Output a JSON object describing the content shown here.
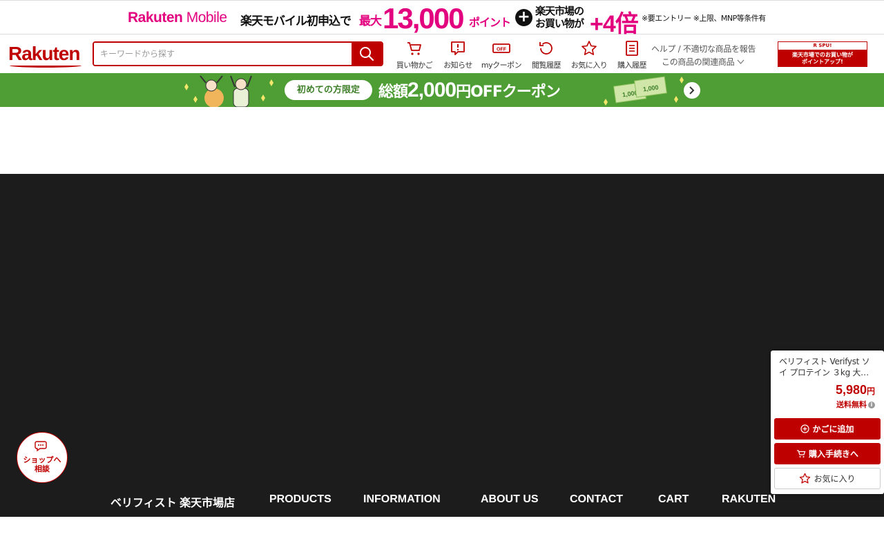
{
  "promo": {
    "brand": "Rakuten",
    "brand_sub": "Mobile",
    "text1": "楽天モバイル初申込で",
    "text2": "最大",
    "points": "13,000",
    "points_unit": "ポイント",
    "plus": "+",
    "text3_line1": "楽天市場の",
    "text3_line2": "お買い物が",
    "multiplier": "+4倍",
    "note": "※要エントリー ※上限、MNP等条件有"
  },
  "header": {
    "logo": "Rakuten",
    "search_placeholder": "キーワードから探す",
    "nav": [
      {
        "label": "買い物かご",
        "icon": "cart-icon"
      },
      {
        "label": "お知らせ",
        "icon": "notice-icon"
      },
      {
        "label": "myクーポン",
        "icon": "coupon-icon"
      },
      {
        "label": "閲覧履歴",
        "icon": "history-icon"
      },
      {
        "label": "お気に入り",
        "icon": "star-icon"
      },
      {
        "label": "購入履歴",
        "icon": "purchase-list-icon"
      }
    ],
    "help_link": "ヘルプ / 不適切な商品を報告",
    "related_link": "この商品の関連商品",
    "spu_top": "R SPU!",
    "spu_line1": "楽天市場でのお買い物が",
    "spu_line2": "ポイントアップ!"
  },
  "coupon": {
    "pill": "初めての方限定",
    "prefix": "総額",
    "amount": "2,000",
    "suffix": "円OFFクーポン",
    "bill": "1,000"
  },
  "shop_nav": [
    "ベリフィスト 楽天市場店",
    "PRODUCTS",
    "INFORMATION",
    "ABOUT US",
    "CONTACT",
    "CART",
    "RAKUTEN"
  ],
  "chat": {
    "line1": "ショップへ",
    "line2": "相談"
  },
  "product_card": {
    "name": "ベリフィスト Verifyst ソイ プロテイン ３kg 大…",
    "price": "5,980",
    "price_unit": "円",
    "shipping": "送料無料",
    "info": "i",
    "add_cart": "かごに追加",
    "checkout": "購入手続きへ",
    "favorite": "お気に入り"
  },
  "colors": {
    "rakuten_red": "#bf0000",
    "promo_pink": "#e3007f",
    "coupon_green": "#4f9e35",
    "dark_bg": "#1c1c1c"
  }
}
